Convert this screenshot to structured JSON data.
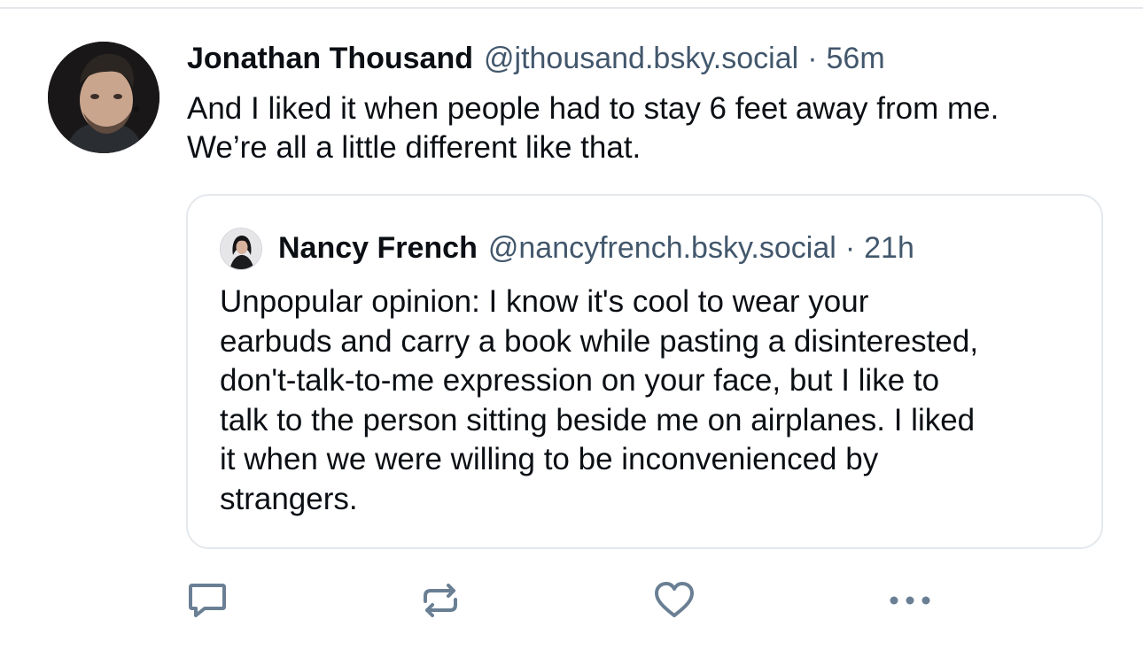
{
  "post": {
    "author": {
      "display_name": "Jonathan Thousand",
      "handle": "@jthousand.bsky.social",
      "avatar_icon": "user-avatar-photo"
    },
    "separator": "·",
    "time": "56m",
    "text_lines": [
      "And I liked it when people had to stay 6 feet away from me.",
      "We’re all a little different like that."
    ]
  },
  "quote": {
    "author": {
      "display_name": "Nancy French",
      "handle": "@nancyfrench.bsky.social",
      "avatar_icon": "user-avatar-photo"
    },
    "separator": "·",
    "time": "21h",
    "text_lines": [
      "Unpopular opinion: I know it's cool to wear your",
      "earbuds and carry a book while pasting a disinterested,",
      "don't-talk-to-me expression on your face, but I like to",
      "talk to the person sitting beside me on airplanes. I liked",
      "it when we were willing to be inconvenienced by",
      "strangers."
    ]
  },
  "actions": [
    {
      "name": "reply",
      "icon": "comment-icon"
    },
    {
      "name": "repost",
      "icon": "repost-icon"
    },
    {
      "name": "like",
      "icon": "heart-icon"
    },
    {
      "name": "more",
      "icon": "more-options-icon"
    }
  ],
  "colors": {
    "text_primary": "#0b0f14",
    "text_secondary": "#42576c",
    "icon": "#6a7f94",
    "border": "#e4e8ec"
  }
}
